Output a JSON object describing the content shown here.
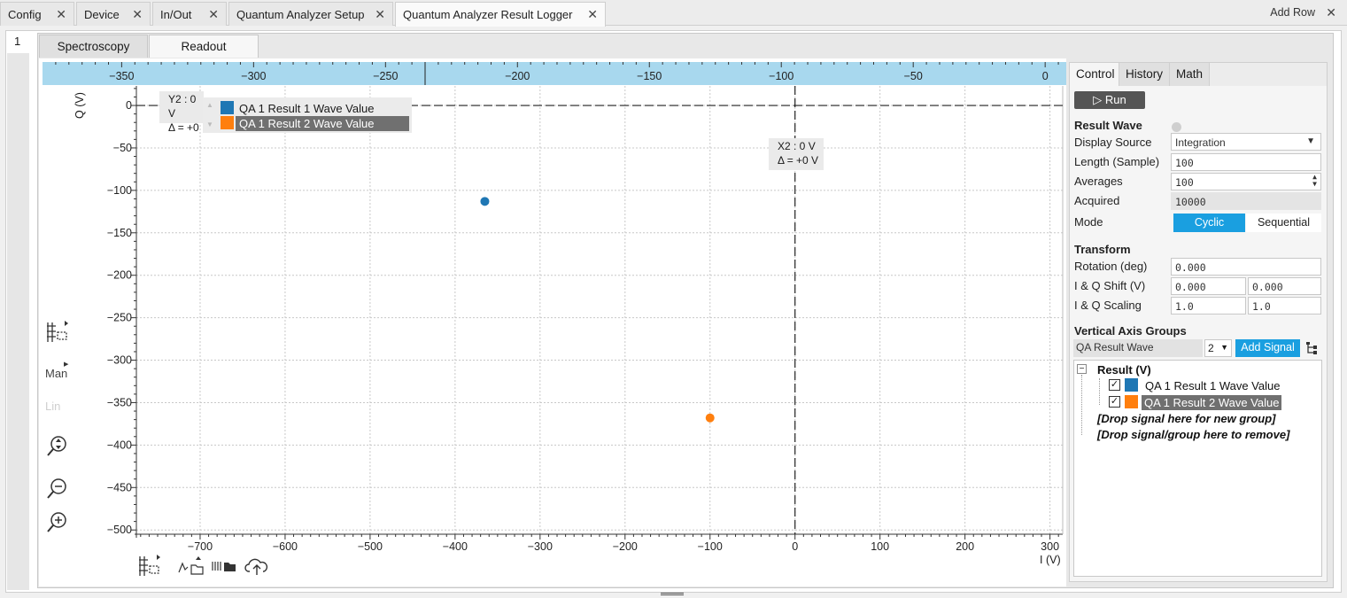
{
  "top_tabs": [
    {
      "label": "Config"
    },
    {
      "label": "Device"
    },
    {
      "label": "In/Out"
    },
    {
      "label": "Quantum Analyzer Setup"
    },
    {
      "label": "Quantum Analyzer Result Logger"
    }
  ],
  "add_row_label": "Add Row",
  "row_tab_label": "1",
  "sub_tabs": {
    "spectroscopy": "Spectroscopy",
    "readout": "Readout"
  },
  "plot": {
    "y_axis_label": "Q (V)",
    "x_axis_label": "I (V)",
    "cursor_y": {
      "line1": "Y2 : 0 V",
      "line2": "Δ = +0"
    },
    "cursor_x": {
      "line1": "X2 : 0 V",
      "line2": "Δ = +0 V"
    },
    "legend": [
      {
        "label": "QA 1 Result 1 Wave Value",
        "color": "#1f77b4"
      },
      {
        "label": "QA 1 Result 2 Wave Value",
        "color": "#ff7f0e"
      }
    ],
    "tools": {
      "man": "Man",
      "lin": "Lin"
    }
  },
  "chart_data": {
    "type": "scatter",
    "title": "",
    "xlabel": "I (V)",
    "ylabel": "Q (V)",
    "xlim": [
      -775,
      315
    ],
    "ylim": [
      -505,
      23
    ],
    "x_ticks": [
      -700,
      -600,
      -500,
      -400,
      -300,
      -200,
      -100,
      0,
      100,
      200,
      300
    ],
    "y_ticks": [
      0,
      -50,
      -100,
      -150,
      -200,
      -250,
      -300,
      -350,
      -400,
      -450,
      -500
    ],
    "top_axis_ticks": [
      -350,
      -300,
      -250,
      -200,
      -150,
      -100,
      -50,
      0
    ],
    "top_axis_range": [
      -380,
      8
    ],
    "grid": true,
    "series": [
      {
        "name": "QA 1 Result 1 Wave Value",
        "color": "#1f77b4",
        "points": [
          {
            "x": -365,
            "y": -113
          }
        ]
      },
      {
        "name": "QA 1 Result 2 Wave Value",
        "color": "#ff7f0e",
        "points": [
          {
            "x": -100,
            "y": -368
          }
        ]
      }
    ]
  },
  "control_panel": {
    "tabs": [
      "Control",
      "History",
      "Math"
    ],
    "run_label": "▷ Run",
    "result_wave": {
      "heading": "Result Wave",
      "display_source_label": "Display Source",
      "display_source_value": "Integration",
      "length_label": "Length (Sample)",
      "length_value": "100",
      "averages_label": "Averages",
      "averages_value": "100",
      "acquired_label": "Acquired",
      "acquired_value": "10000",
      "mode_label": "Mode",
      "mode_cyclic": "Cyclic",
      "mode_sequential": "Sequential"
    },
    "transform": {
      "heading": "Transform",
      "rotation_label": "Rotation (deg)",
      "rotation_value": "0.000",
      "shift_label": "I & Q Shift (V)",
      "shift_i": "0.000",
      "shift_q": "0.000",
      "scaling_label": "I & Q Scaling",
      "scaling_i": "1.0",
      "scaling_q": "1.0"
    },
    "vertical_axis_groups": {
      "heading": "Vertical Axis Groups",
      "signal_source": "QA Result Wave",
      "channel_value": "2",
      "add_signal_label": "Add Signal",
      "tree_group_label": "Result (V)",
      "tree_items": [
        "QA 1 Result 1 Wave Value",
        "QA 1 Result 2 Wave Value"
      ],
      "drop_new_group": "[Drop signal here for new group]",
      "drop_remove": "[Drop signal/group here to remove]"
    }
  }
}
